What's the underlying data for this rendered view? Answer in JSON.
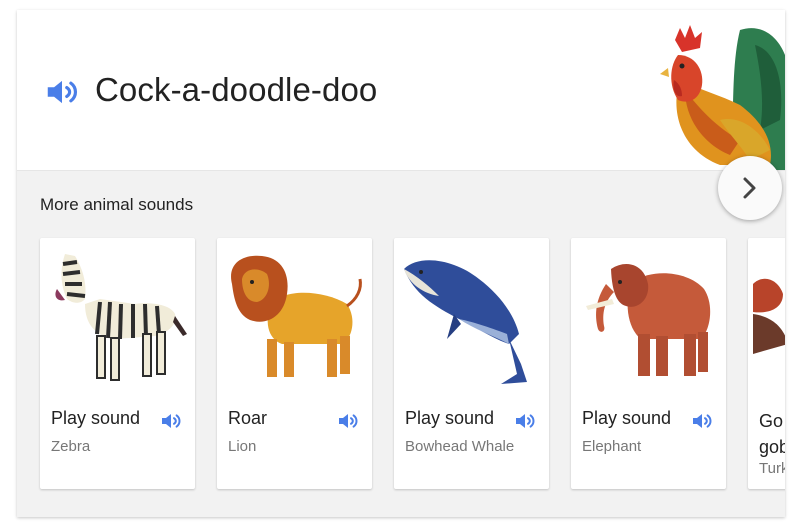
{
  "header": {
    "title": "Cock-a-doodle-doo",
    "speaker_icon": "speaker-icon",
    "image": "rooster-illustration"
  },
  "section": {
    "title": "More animal sounds"
  },
  "cards": [
    {
      "label": "Play sound",
      "sub": "Zebra",
      "icon": "speaker-icon"
    },
    {
      "label": "Roar",
      "sub": "Lion",
      "icon": "speaker-icon"
    },
    {
      "label": "Play sound",
      "sub": "Bowhead Whale",
      "icon": "speaker-icon"
    },
    {
      "label": "Play sound",
      "sub": "Elephant",
      "icon": "speaker-icon"
    },
    {
      "label": "Go gob",
      "sub": "Turk",
      "icon": "speaker-icon"
    }
  ],
  "colors": {
    "accent_blue": "#4a7ee8",
    "text": "#222222",
    "subtext": "#777777",
    "section_bg": "#f2f2f2"
  },
  "carousel": {
    "next_icon": "chevron-right-icon"
  }
}
